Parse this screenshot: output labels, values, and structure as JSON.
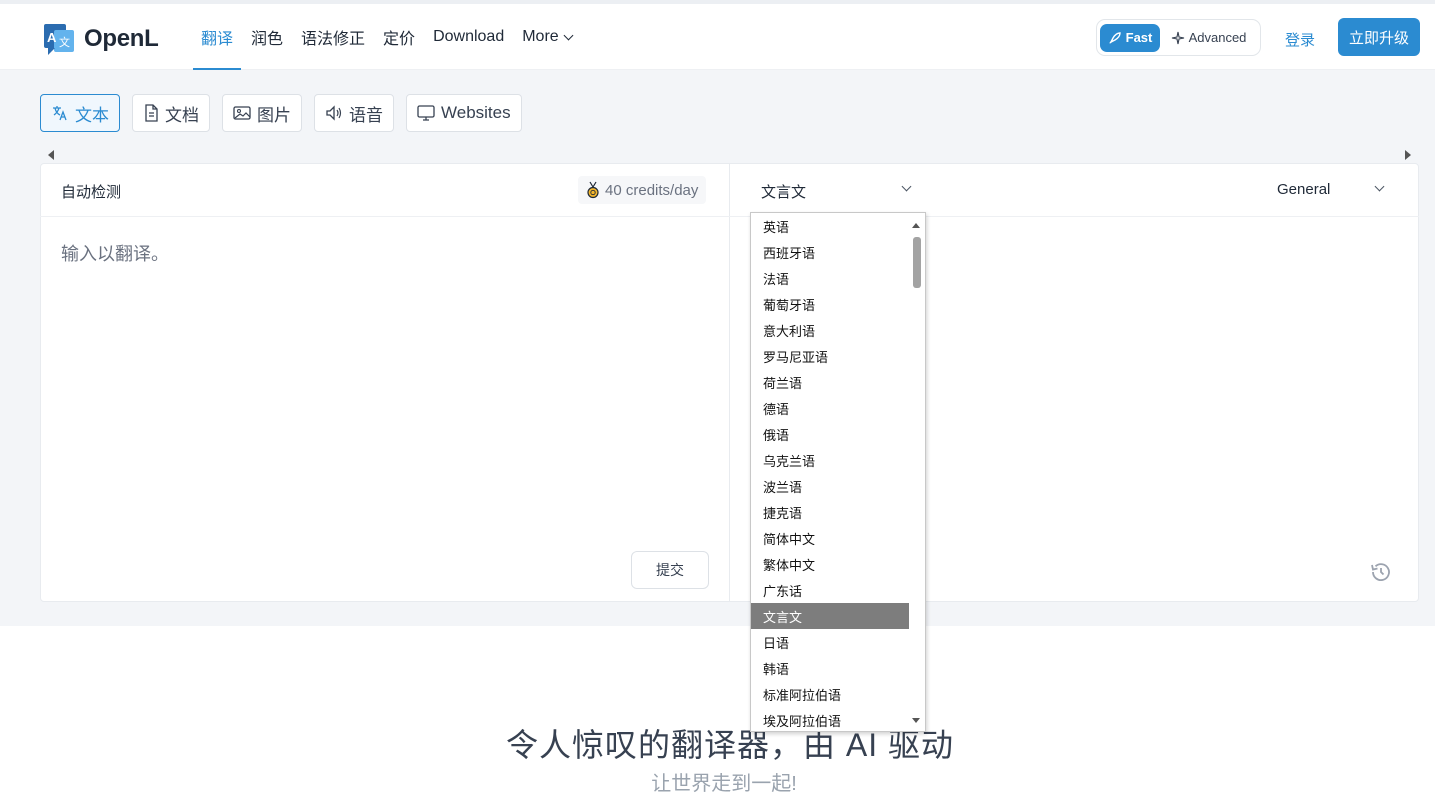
{
  "brand": {
    "name": "OpenL"
  },
  "nav": {
    "items": [
      {
        "label": "翻译",
        "active": true
      },
      {
        "label": "润色",
        "active": false
      },
      {
        "label": "语法修正",
        "active": false
      },
      {
        "label": "定价",
        "active": false
      },
      {
        "label": "Download",
        "active": false
      },
      {
        "label": "More",
        "active": false
      }
    ]
  },
  "mode": {
    "fast": "Fast",
    "advanced": "Advanced"
  },
  "auth": {
    "login": "登录",
    "upgrade": "立即升级"
  },
  "tabs": [
    {
      "label": "文本",
      "icon": "translate-icon",
      "active": true
    },
    {
      "label": "文档",
      "icon": "document-icon",
      "active": false
    },
    {
      "label": "图片",
      "icon": "image-icon",
      "active": false
    },
    {
      "label": "语音",
      "icon": "speaker-icon",
      "active": false
    },
    {
      "label": "Websites",
      "icon": "monitor-icon",
      "active": false
    }
  ],
  "source": {
    "language": "自动检测",
    "credits": "40 credits/day",
    "placeholder": "输入以翻译。",
    "submit": "提交"
  },
  "target": {
    "language": "文言文",
    "style": "General"
  },
  "language_dropdown": {
    "selected": "文言文",
    "options": [
      "英语",
      "西班牙语",
      "法语",
      "葡萄牙语",
      "意大利语",
      "罗马尼亚语",
      "荷兰语",
      "德语",
      "俄语",
      "乌克兰语",
      "波兰语",
      "捷克语",
      "简体中文",
      "繁体中文",
      "广东话",
      "文言文",
      "日语",
      "韩语",
      "标准阿拉伯语",
      "埃及阿拉伯语"
    ]
  },
  "hero": {
    "title": "令人惊叹的翻译器，由 AI 驱动",
    "subtitle": "让世界走到一起!"
  },
  "colors": {
    "accent": "#2b8bd1",
    "selected_option": "#7d7d7d"
  }
}
